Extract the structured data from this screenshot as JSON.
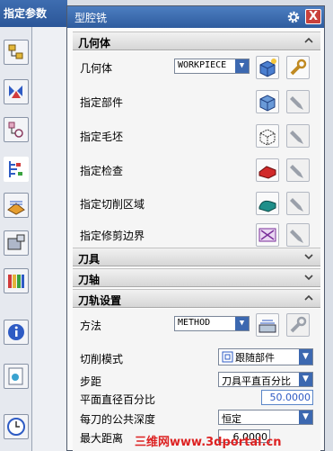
{
  "left_panel": {
    "header": "指定参数"
  },
  "dialog": {
    "title": "型腔铣",
    "close_label": "X",
    "geometry": {
      "header": "几何体",
      "geometry_label": "几何体",
      "geometry_value": "WORKPIECE",
      "part_label": "指定部件",
      "blank_label": "指定毛坯",
      "check_label": "指定检查",
      "cut_area_label": "指定切削区域",
      "trim_label": "指定修剪边界"
    },
    "tool": {
      "header": "刀具"
    },
    "axis": {
      "header": "刀轴"
    },
    "path": {
      "header": "刀轨设置",
      "method_label": "方法",
      "method_value": "METHOD",
      "cut_pattern_label": "切削模式",
      "cut_pattern_value": "跟随部件",
      "stepover_label": "步距",
      "stepover_value": "刀具平直百分比",
      "percent_label": "平面直径百分比",
      "percent_value": "50.0000",
      "depth_label": "每刀的公共深度",
      "depth_value": "恒定",
      "max_dist_label": "最大距离",
      "max_dist_value": "6.0000"
    }
  },
  "watermark": "三维网www.3dportal.cn"
}
